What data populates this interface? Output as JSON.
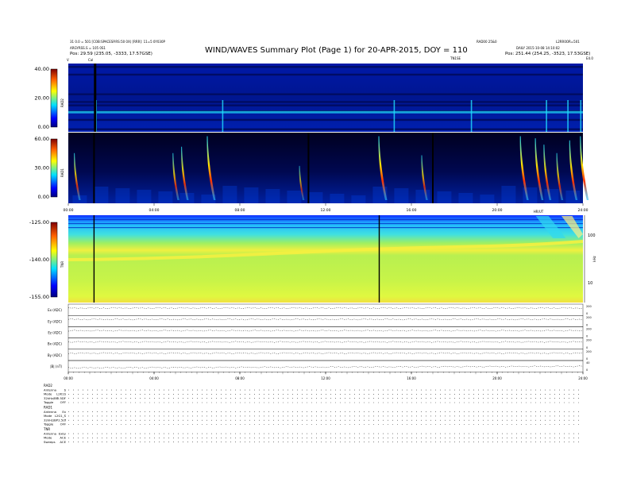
{
  "header": {
    "left_line1": "31 0.0 = 501 [COB:SPACESP.RS:50 0X) [RRR]: 11=5 0Y030P",
    "left_line2": "ARGYRSS.S = 105 0S1",
    "left_line3": "Pos: 29.59 (235.05, -3333, 17.57GSE)",
    "title": "WIND/WAVES Summary Plot (Page 1) for 20-APR-2015, DOY = 110",
    "right_top_1": "RAD00 25&0",
    "right_top_2": "L2RR0OR=501",
    "right_line2": "DAILY  2015-10-08 14:10:02",
    "right_line3": "Pos: 251.44 (254.25, -3523, 17.53GSE)",
    "marker_cal": "Cal",
    "marker_left": "V",
    "marker_right_label": "TN1SE",
    "marker_right": "E4.0"
  },
  "colors": {
    "bg_dark": "#000a5a",
    "bg_blue": "#0010a0",
    "burst_cyan": "#20e0ff",
    "burst_yellow": "#ffe000",
    "burst_red": "#e01000",
    "tnr_green": "#a8f050",
    "tnr_yellow": "#e8f840",
    "tnr_cyan": "#30d8f0"
  },
  "chart_data": [
    {
      "type": "heatmap",
      "name": "RAD2",
      "colorbar_ticks": [
        "40.00",
        "20.00",
        "0.00"
      ],
      "ylim": [
        0,
        40
      ],
      "dark_bands": [
        1.5,
        7.0,
        12.0,
        15.5,
        17.5,
        22.0,
        33.5,
        38.0
      ],
      "bright_events_hour": [
        1.3,
        7.2,
        15.2,
        18.8,
        22.3,
        23.3,
        23.9
      ]
    },
    {
      "type": "heatmap",
      "name": "RAD1",
      "colorbar_ticks": [
        "60.00",
        "30.00",
        "0.00"
      ],
      "ylim": [
        0,
        60
      ],
      "x_ticks": [
        "00:00",
        "04:00",
        "08:00",
        "12:00",
        "16:00",
        "20:00",
        "24:00"
      ],
      "xlim": [
        0,
        24
      ],
      "bursts": [
        {
          "hour": 0.3,
          "intensity": 0.6
        },
        {
          "hour": 4.9,
          "intensity": 0.6
        },
        {
          "hour": 5.3,
          "intensity": 0.75
        },
        {
          "hour": 6.5,
          "intensity": 1.0
        },
        {
          "hour": 10.8,
          "intensity": 0.3
        },
        {
          "hour": 14.5,
          "intensity": 1.0
        },
        {
          "hour": 16.5,
          "intensity": 0.55
        },
        {
          "hour": 21.1,
          "intensity": 1.0
        },
        {
          "hour": 21.8,
          "intensity": 0.95
        },
        {
          "hour": 22.2,
          "intensity": 0.8
        },
        {
          "hour": 22.8,
          "intensity": 0.6
        },
        {
          "hour": 23.4,
          "intensity": 0.9
        },
        {
          "hour": 23.9,
          "intensity": 1.0
        }
      ],
      "dark_lines_hour": [
        1.2,
        11.2,
        17.0
      ]
    },
    {
      "type": "heatmap",
      "name": "TNR",
      "colorbar_ticks": [
        "-125.00",
        "-140.00",
        "-155.00"
      ],
      "ylim": [
        -155,
        -125
      ],
      "right_axis_ticks": [
        "100",
        "10"
      ],
      "right_axis_label": "kHz",
      "time_label": "HR/UT",
      "lines_hour": [
        1.2,
        14.5
      ]
    },
    {
      "type": "line",
      "name": "Housekeeping",
      "panels": [
        {
          "label": "Ex (ADC)",
          "ticks": [
            "200",
            "0"
          ]
        },
        {
          "label": "Ey (ADC)",
          "ticks": [
            "200",
            "0"
          ]
        },
        {
          "label": "Ez (ADC)",
          "ticks": [
            "200",
            "0"
          ]
        },
        {
          "label": "Bx (ADC)",
          "ticks": [
            "200",
            "0"
          ]
        },
        {
          "label": "By (ADC)",
          "ticks": [
            "200",
            "0"
          ]
        },
        {
          "label": "|B| (nT)",
          "ticks": [
            "40",
            "0"
          ]
        }
      ],
      "x_ticks": [
        "00:00",
        "04:00",
        "08:00",
        "12:00",
        "16:00",
        "20:00",
        "24:00"
      ],
      "xlim": [
        0,
        24
      ]
    }
  ],
  "status_blocks": [
    {
      "name": "RAD2",
      "rows": [
        [
          "Antenna",
          "S"
        ],
        [
          "Mode",
          "L2K1S"
        ],
        [
          "32kHz/BP",
          "2.5DF"
        ],
        [
          "Toggle",
          "OFF"
        ]
      ]
    },
    {
      "name": "RAD1",
      "rows": [
        [
          "Antenna",
          "Ex"
        ],
        [
          "Mode",
          "L2G1_S"
        ],
        [
          "32kHz/BP",
          "2.5df"
        ],
        [
          "Toggle",
          "OFF"
        ]
      ]
    },
    {
      "name": "TNR",
      "rows": [
        [
          "Antenna",
          "ExEy"
        ],
        [
          "Mode",
          "ACE"
        ],
        [
          "Sweeps",
          "ACE"
        ]
      ]
    }
  ]
}
